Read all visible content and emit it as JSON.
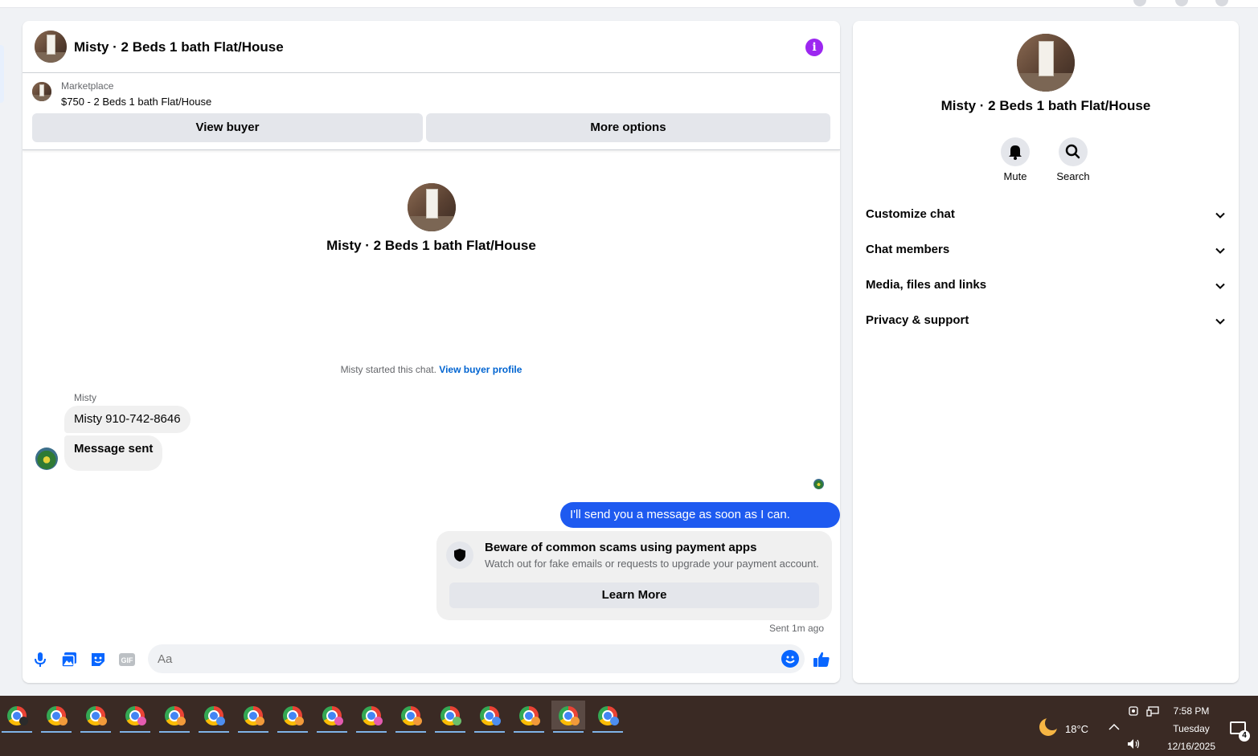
{
  "chat": {
    "header_title": "Misty · 2 Beds 1 bath Flat/House",
    "marketplace_label": "Marketplace",
    "listing": "$750 - 2 Beds 1 bath Flat/House",
    "view_buyer": "View buyer",
    "more_options": "More options",
    "center_title": "Misty · 2 Beds 1 bath Flat/House",
    "started_text": "Misty started this chat.",
    "view_buyer_profile": "View buyer profile",
    "sender_name": "Misty",
    "messages_in": [
      "Misty 910-742-8646",
      "Message sent"
    ],
    "message_out": "I'll send you a message as soon as I can. Thanks",
    "scam_title": "Beware of common scams using payment apps",
    "scam_subtitle": "Watch out for fake emails or requests to upgrade your payment account.",
    "learn_more": "Learn More",
    "sent_time": "Sent 1m ago",
    "composer_placeholder": "Aa",
    "accent_color": "#0866ff",
    "outgoing_bubble_color": "#1e5af0",
    "info_icon_color": "#9c27f0"
  },
  "info_panel": {
    "title": "Misty · 2 Beds 1 bath Flat/House",
    "mute": "Mute",
    "search": "Search",
    "sections": [
      "Customize chat",
      "Chat members",
      "Media, files and links",
      "Privacy & support"
    ]
  },
  "taskbar": {
    "app_count": 16,
    "temperature": "18°C",
    "time": "7:58 PM",
    "day": "Tuesday",
    "date": "12/16/2025",
    "notification_count": "4"
  }
}
